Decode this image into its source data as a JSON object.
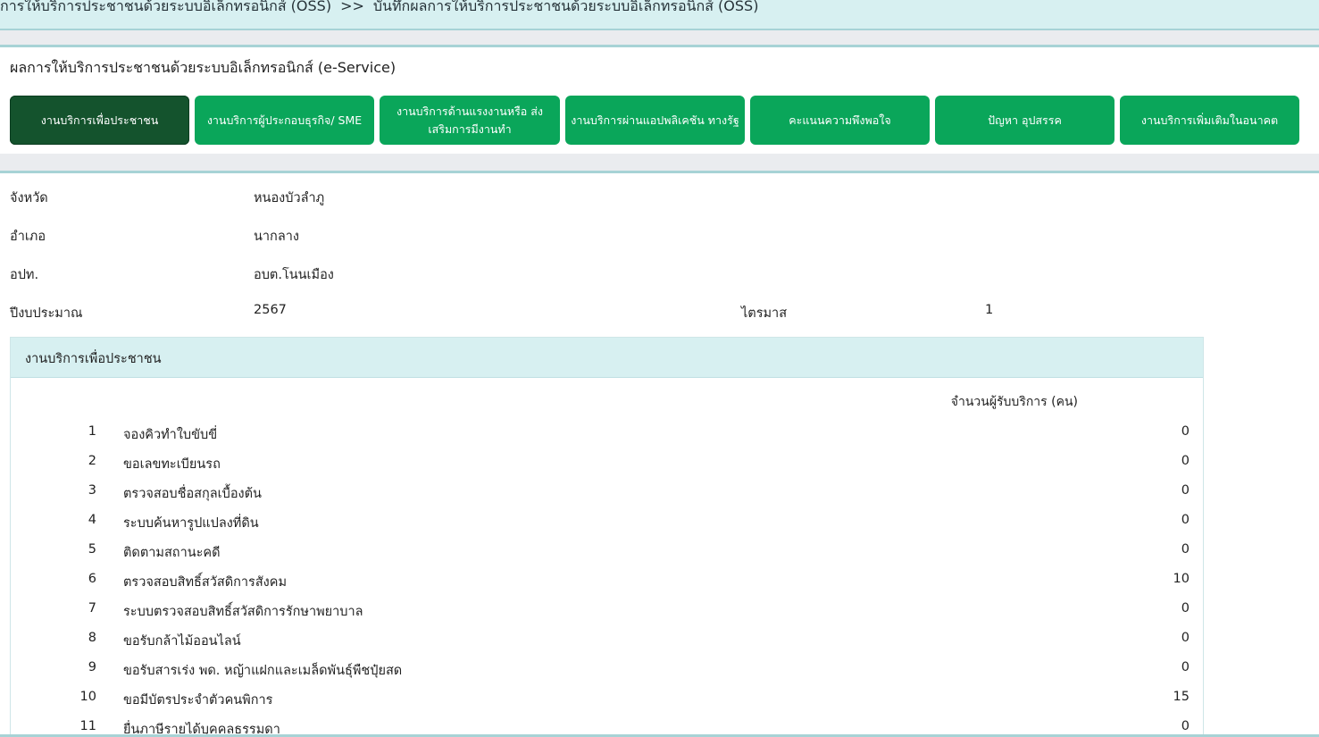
{
  "breadcrumb": {
    "part1": "การให้บริการประชาชนด้วยระบบอิเล็กทรอนิกส์ (OSS)",
    "separator": ">>",
    "part2": "บันทึกผลการให้บริการประชาชนด้วยระบบอิเล็กทรอนิกส์ (OSS)"
  },
  "panel_title": "ผลการให้บริการประชาชนด้วยระบบอิเล็กทรอนิกส์ (e-Service)",
  "tabs": [
    {
      "label": "งานบริการเพื่อประชาชน"
    },
    {
      "label": "งานบริการผู้ประกอบธุรกิจ/ SME"
    },
    {
      "label": "งานบริการด้านแรงงานหรือ ส่งเสริมการมีงานทำ"
    },
    {
      "label": "งานบริการผ่านแอปพลิเคชัน ทางรัฐ"
    },
    {
      "label": "คะแนนความพึงพอใจ"
    },
    {
      "label": "ปัญหา อุปสรรค"
    },
    {
      "label": "งานบริการเพิ่มเติมในอนาคต"
    }
  ],
  "info": {
    "province_label": "จังหวัด",
    "province_value": "หนองบัวลำภู",
    "district_label": "อำเภอ",
    "district_value": "นากลาง",
    "lao_label": "อปท.",
    "lao_value": "อบต.โนนเมือง",
    "year_label": "ปีงบประมาณ",
    "year_value": "2567",
    "quarter_label": "ไตรมาส",
    "quarter_value": "1"
  },
  "card": {
    "title": "งานบริการเพื่อประชาชน",
    "count_header": "จำนวนผู้รับบริการ (คน)",
    "rows": [
      {
        "no": "1",
        "name": "จองคิวทำใบขับขี่",
        "count": "0"
      },
      {
        "no": "2",
        "name": "ขอเลขทะเบียนรถ",
        "count": "0"
      },
      {
        "no": "3",
        "name": "ตรวจสอบชื่อสกุลเบื้องต้น",
        "count": "0"
      },
      {
        "no": "4",
        "name": "ระบบค้นหารูปแปลงที่ดิน",
        "count": "0"
      },
      {
        "no": "5",
        "name": "ติดตามสถานะคดี",
        "count": "0"
      },
      {
        "no": "6",
        "name": "ตรวจสอบสิทธิ์สวัสดิการสังคม",
        "count": "10"
      },
      {
        "no": "7",
        "name": "ระบบตรวจสอบสิทธิ์สวัสดิการรักษาพยาบาล",
        "count": "0"
      },
      {
        "no": "8",
        "name": "ขอรับกล้าไม้ออนไลน์",
        "count": "0"
      },
      {
        "no": "9",
        "name": "ขอรับสารเร่ง พด. หญ้าแฝกและเมล็ดพันธุ์พืชปุ๋ยสด",
        "count": "0"
      },
      {
        "no": "10",
        "name": "ขอมีบัตรประจำตัวคนพิการ",
        "count": "15"
      },
      {
        "no": "11",
        "name": "ยื่นภาษีรายได้บุคคลธรรมดา",
        "count": "0"
      }
    ]
  }
}
